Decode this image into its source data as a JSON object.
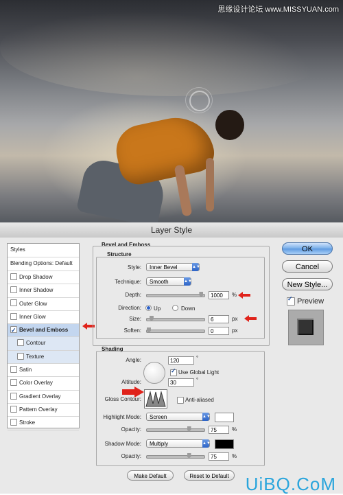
{
  "watermark": "思缘设计论坛 www.MISSYUAN.com",
  "window_title": "Layer Style",
  "sidebar": {
    "items": [
      {
        "label": "Styles",
        "checkbox": false,
        "checked": false,
        "selected": false,
        "sub": false
      },
      {
        "label": "Blending Options: Default",
        "checkbox": false,
        "checked": false,
        "selected": false,
        "sub": false
      },
      {
        "label": "Drop Shadow",
        "checkbox": true,
        "checked": false,
        "selected": false,
        "sub": false
      },
      {
        "label": "Inner Shadow",
        "checkbox": true,
        "checked": false,
        "selected": false,
        "sub": false
      },
      {
        "label": "Outer Glow",
        "checkbox": true,
        "checked": false,
        "selected": false,
        "sub": false
      },
      {
        "label": "Inner Glow",
        "checkbox": true,
        "checked": false,
        "selected": false,
        "sub": false
      },
      {
        "label": "Bevel and Emboss",
        "checkbox": true,
        "checked": true,
        "selected": true,
        "sub": false
      },
      {
        "label": "Contour",
        "checkbox": true,
        "checked": false,
        "selected": false,
        "sub": true
      },
      {
        "label": "Texture",
        "checkbox": true,
        "checked": false,
        "selected": false,
        "sub": true
      },
      {
        "label": "Satin",
        "checkbox": true,
        "checked": false,
        "selected": false,
        "sub": false
      },
      {
        "label": "Color Overlay",
        "checkbox": true,
        "checked": false,
        "selected": false,
        "sub": false
      },
      {
        "label": "Gradient Overlay",
        "checkbox": true,
        "checked": false,
        "selected": false,
        "sub": false
      },
      {
        "label": "Pattern Overlay",
        "checkbox": true,
        "checked": false,
        "selected": false,
        "sub": false
      },
      {
        "label": "Stroke",
        "checkbox": true,
        "checked": false,
        "selected": false,
        "sub": false
      }
    ]
  },
  "bevel": {
    "title": "Bevel and Emboss",
    "structure_title": "Structure",
    "style_label": "Style:",
    "style_value": "Inner Bevel",
    "technique_label": "Technique:",
    "technique_value": "Smooth",
    "depth_label": "Depth:",
    "depth_value": "1000",
    "depth_unit": "%",
    "depth_level": 0.98,
    "direction_label": "Direction:",
    "dir_up": "Up",
    "dir_down": "Down",
    "size_label": "Size:",
    "size_value": "6",
    "size_unit": "px",
    "size_level": 0.05,
    "soften_label": "Soften:",
    "soften_value": "0",
    "soften_unit": "px",
    "soften_level": 0.0
  },
  "shading": {
    "title": "Shading",
    "angle_label": "Angle:",
    "angle_value": "120",
    "angle_unit": "°",
    "global_light_label": "Use Global Light",
    "altitude_label": "Altitude:",
    "altitude_value": "30",
    "altitude_unit": "°",
    "gloss_label": "Gloss Contour:",
    "anti_aliased_label": "Anti-aliased",
    "highlight_mode_label": "Highlight Mode:",
    "highlight_mode_value": "Screen",
    "highlight_color": "#ffffff",
    "h_opacity_label": "Opacity:",
    "h_opacity_value": "75",
    "h_opacity_unit": "%",
    "h_opacity_level": 0.75,
    "shadow_mode_label": "Shadow Mode:",
    "shadow_mode_value": "Multiply",
    "shadow_color": "#000000",
    "s_opacity_label": "Opacity:",
    "s_opacity_value": "75",
    "s_opacity_unit": "%",
    "s_opacity_level": 0.75
  },
  "buttons": {
    "make_default": "Make Default",
    "reset_default": "Reset to Default",
    "ok": "OK",
    "cancel": "Cancel",
    "new_style": "New Style...",
    "preview": "Preview"
  },
  "bottom_watermark": "UiBQ.CoM",
  "colors": {
    "accent": "#2a5fc7",
    "arrow": "#e0231b",
    "selection": "#c3d6ef"
  }
}
